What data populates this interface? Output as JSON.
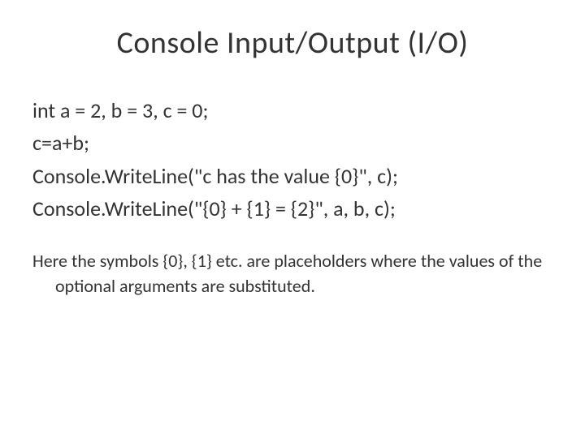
{
  "title": "Console Input/Output (I/O)",
  "code": {
    "line1": "int a = 2, b = 3, c = 0;",
    "line2": "c=a+b;",
    "line3": "Console.WriteLine(\"c has the value {0}\", c);",
    "line4": "Console.WriteLine(\"{0} + {1} = {2}\", a, b, c);"
  },
  "explanation": "Here the symbols {0}, {1} etc. are placeholders where the values of the optional arguments are substituted."
}
